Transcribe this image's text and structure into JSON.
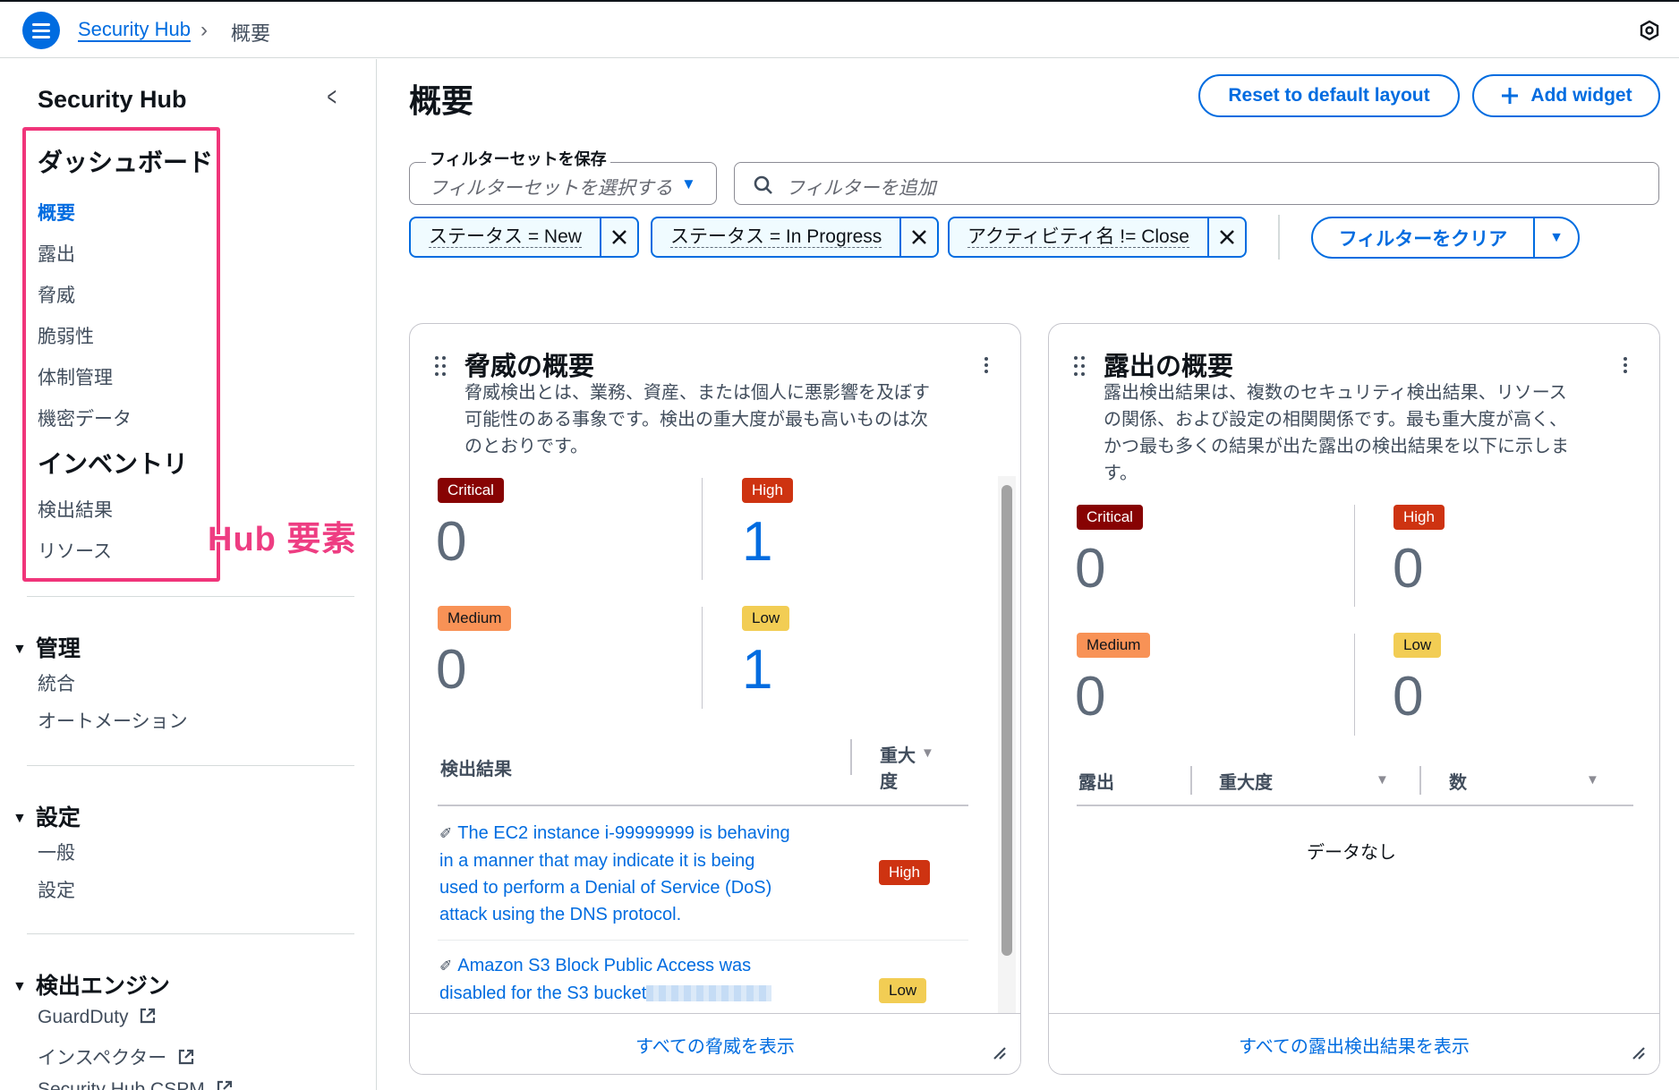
{
  "topbar": {
    "breadcrumb_link": "Security Hub",
    "breadcrumb_separator": "›",
    "breadcrumb_current": "概要"
  },
  "sidebar": {
    "title": "Security Hub",
    "dashboard_section": "ダッシュボード",
    "dashboard_items": [
      "概要",
      "露出",
      "脅威",
      "脆弱性",
      "体制管理",
      "機密データ"
    ],
    "inventory_section": "インベントリ",
    "inventory_items": [
      "検出結果",
      "リソース"
    ],
    "annotation": "Hub 要素",
    "groups": [
      {
        "title": "管理",
        "items": [
          "統合",
          "オートメーション"
        ]
      },
      {
        "title": "設定",
        "items": [
          "一般",
          "設定"
        ]
      },
      {
        "title": "検出エンジン",
        "items": [
          "GuardDuty",
          "インスペクター",
          "Security Hub CSPM"
        ]
      }
    ]
  },
  "main": {
    "title": "概要",
    "reset_button": "Reset to default layout",
    "add_widget_button": "Add widget",
    "filter_set_label": "フィルターセットを保存",
    "filter_set_placeholder": "フィルターセットを選択する",
    "search_placeholder": "フィルターを追加",
    "tokens": [
      "ステータス = New",
      "ステータス = In Progress",
      "アクティビティ名 != Close"
    ],
    "clear_filters": "フィルターをクリア"
  },
  "threats_widget": {
    "title": "脅威の概要",
    "description": [
      "脅威検出とは、業務、資産、または個人に悪影響を及ぼす",
      "可能性のある事象です。検出の重大度が最も高いものは次",
      "のとおりです。"
    ],
    "severities": [
      {
        "label": "Critical",
        "count": "0"
      },
      {
        "label": "High",
        "count": "1"
      },
      {
        "label": "Medium",
        "count": "0"
      },
      {
        "label": "Low",
        "count": "1"
      }
    ],
    "table_headers": {
      "findings": "検出結果",
      "severity_line1": "重大",
      "severity_line2": "度"
    },
    "findings": [
      {
        "lines": [
          "The EC2 instance i-99999999 is behaving",
          "in a manner that may indicate it is being",
          "used to perform a Denial of Service (DoS)",
          "attack using the DNS protocol."
        ],
        "severity": "High"
      },
      {
        "lines": [
          "Amazon S3 Block Public Access was",
          "disabled for the S3 bucket"
        ],
        "severity": "Low"
      }
    ],
    "footer_link": "すべての脅威を表示"
  },
  "exposure_widget": {
    "title": "露出の概要",
    "description": [
      "露出検出結果は、複数のセキュリティ検出結果、リソース",
      "の関係、および設定の相関関係です。最も重大度が高く、",
      "かつ最も多くの結果が出た露出の検出結果を以下に示しま",
      "す。"
    ],
    "severities": [
      {
        "label": "Critical",
        "count": "0"
      },
      {
        "label": "High",
        "count": "0"
      },
      {
        "label": "Medium",
        "count": "0"
      },
      {
        "label": "Low",
        "count": "0"
      }
    ],
    "table_headers": {
      "exposure": "露出",
      "severity": "重大度",
      "count": "数"
    },
    "no_data": "データなし",
    "footer_link": "すべての露出検出結果を表示"
  },
  "colors": {
    "accent": "#006ce0",
    "annotation": "#f0357a",
    "critical": "#870303",
    "high": "#ce3311",
    "medium": "#f89256",
    "low": "#f2cd54"
  },
  "icons": [
    "menu-icon",
    "chevron-right-icon",
    "notifications-icon",
    "chevron-left-icon",
    "search-icon",
    "close-icon",
    "caret-down-icon",
    "plus-icon",
    "drag-handle-icon",
    "more-vertical-icon",
    "external-link-icon",
    "resize-icon"
  ]
}
